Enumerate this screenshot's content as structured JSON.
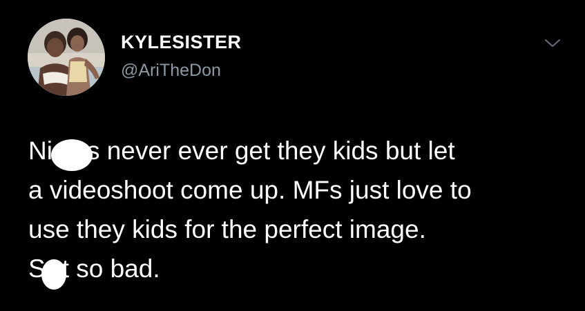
{
  "tweet": {
    "author": {
      "display_name": "KYLESISTER",
      "handle": "@AriTheDon",
      "avatar_icon": "profile-photo"
    },
    "menu_icon": "chevron-down-icon",
    "text_lines": [
      {
        "before": "Ni",
        "after": "s never ever get they kids but let"
      },
      {
        "text": "a videoshoot come up. MFs just love to"
      },
      {
        "text": "use they kids for the perfect image."
      },
      {
        "before": "S",
        "after": "t so bad."
      }
    ]
  },
  "colors": {
    "background": "#000000",
    "text": "#ffffff",
    "handle": "#8b98a5",
    "redaction": "#ffffff"
  }
}
